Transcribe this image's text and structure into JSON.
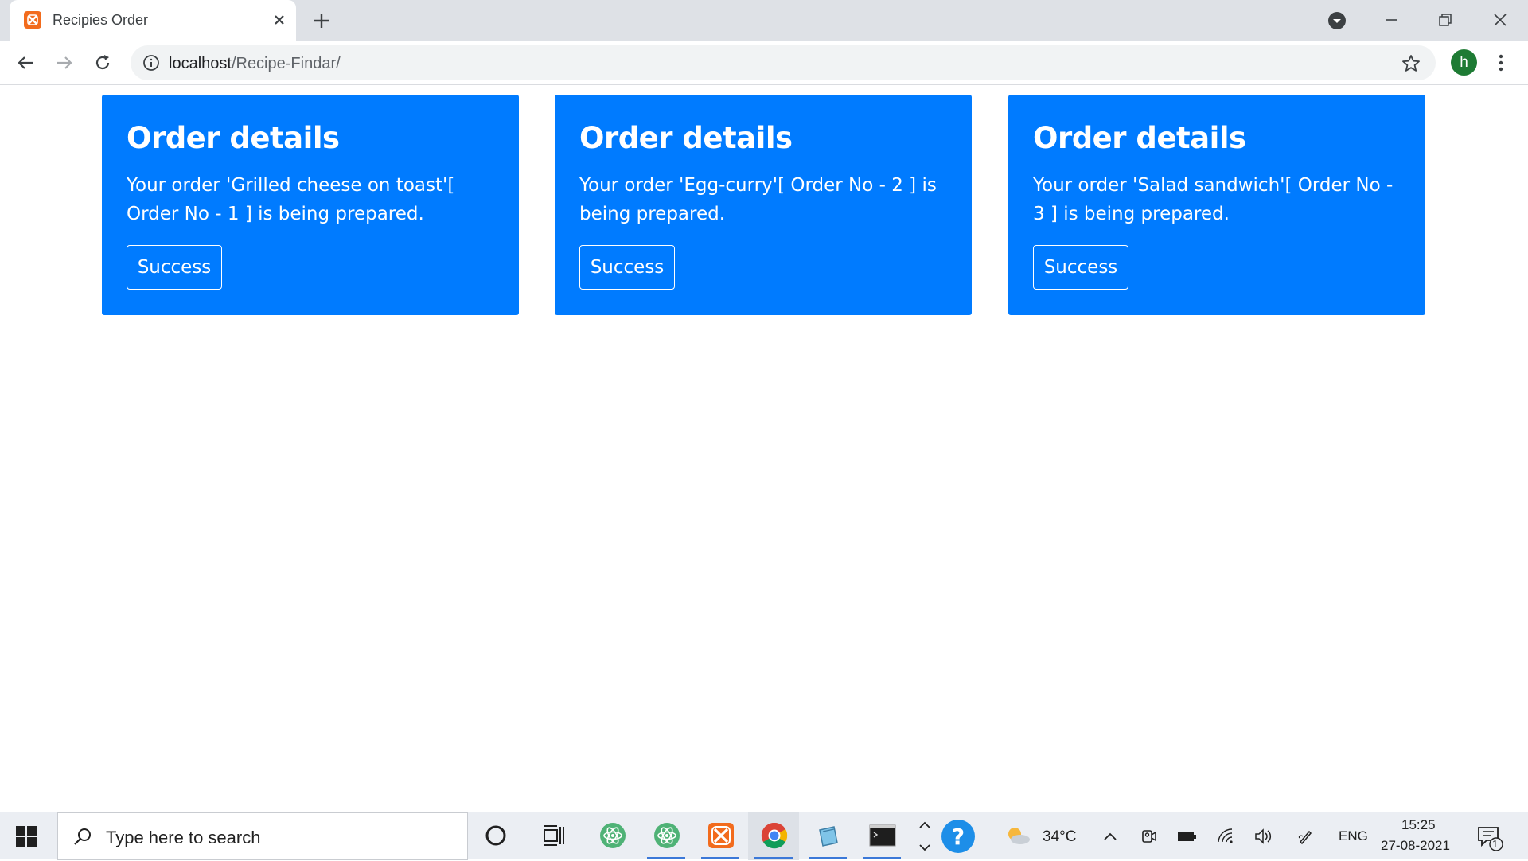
{
  "browser": {
    "tab_title": "Recipies Order",
    "url_host": "localhost",
    "url_path": "/Recipe-Findar/",
    "profile_initial": "h"
  },
  "orders": [
    {
      "title": "Order details",
      "text": "Your order 'Grilled cheese on toast'[ Order No - 1 ] is being prepared.",
      "button": "Success"
    },
    {
      "title": "Order details",
      "text": "Your order 'Egg-curry'[ Order No - 2 ] is being prepared.",
      "button": "Success"
    },
    {
      "title": "Order details",
      "text": "Your order 'Salad sandwich'[ Order No - 3 ] is being prepared.",
      "button": "Success"
    }
  ],
  "taskbar": {
    "search_placeholder": "Type here to search",
    "temperature": "34°C",
    "language": "ENG",
    "time": "15:25",
    "date": "27-08-2021",
    "notification_count": "1"
  },
  "colors": {
    "card_bg": "#007bff",
    "tab_strip": "#dee1e6",
    "taskbar_bg": "#ebeef3",
    "xampp_orange": "#f26b1d"
  }
}
